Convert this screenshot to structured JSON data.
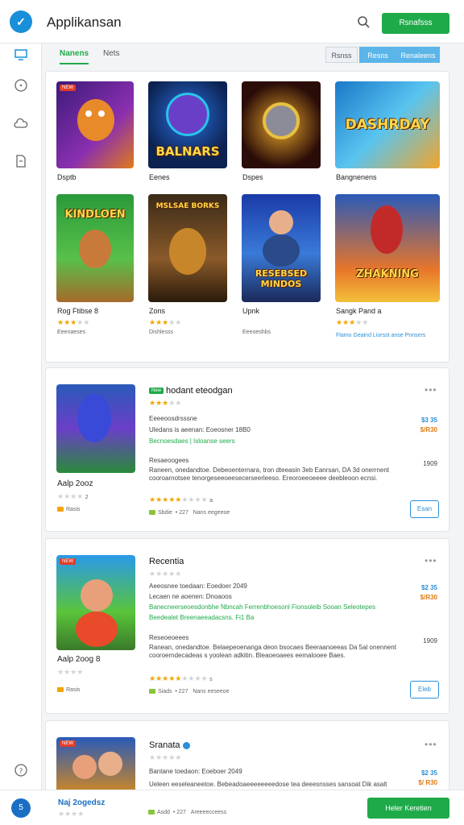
{
  "header": {
    "logo_letter": "✓",
    "title": "Applikansan",
    "primary_button": "Rsnafsss"
  },
  "tabs": [
    {
      "label": "Nanens",
      "active": true
    },
    {
      "label": "Nets",
      "active": false
    }
  ],
  "segment_buttons": [
    {
      "label": "Rsnss",
      "active": false
    },
    {
      "label": "Resns",
      "active": true
    },
    {
      "label": "Renaleens",
      "active": true
    }
  ],
  "featured": [
    {
      "name": "Dsptb",
      "art_text": "",
      "stars": 0,
      "note": ""
    },
    {
      "name": "Eenes",
      "art_text": "BALNARS",
      "stars": 0,
      "note": ""
    },
    {
      "name": "Dspes",
      "art_text": "",
      "stars": 0,
      "note": ""
    },
    {
      "name": "Bangnenens",
      "art_text": "DASHRDAY",
      "stars": 0,
      "note": ""
    },
    {
      "name": "Rog Ftibse 8",
      "art_text": "KINDLOEN",
      "stars": 2.5,
      "note": "Eeenaeses"
    },
    {
      "name": "Zons",
      "art_text": "MSLSAE BORKS",
      "stars": 2.5,
      "note": "Dishlesss"
    },
    {
      "name": "Upnk",
      "art_text": "RESEBSED MINDOS",
      "stars": 0,
      "note": "Eeeoeshbs"
    },
    {
      "name": "Sangk Pand a",
      "art_text": "ZHAKNING",
      "stars": 2.5,
      "note": "Flamo Geaind Liorsst anse Pnnsers"
    }
  ],
  "list_items": [
    {
      "badge": "New",
      "title": "hodant eteodgan",
      "stars": 3,
      "thumb_name": "Aalp 2ooz",
      "thumb_stars": 0,
      "thumb_count": "2",
      "thumb_tag": "Rasis",
      "meta_1": "Eeeeoosdrsssne",
      "meta_2": "Uledans is aeenan: Eoeosner 18B0",
      "meta_green": "Becnoesdaes | Isloanse seers",
      "price_1": "$3 35",
      "price_2": "$/R30",
      "desc_heading": "Resaeoogees",
      "desc_date": "1909",
      "desc": "Raneen, onedandtoe. Debeoenternara, tron dteeasin 3eb Eanrsan, DA 3d onerrnent cooroarnotsee tenorgeseeoeesecerseerleeso. Ereoroeeoeeee deebleoon ecnsi.",
      "review_stars": 5,
      "review_empty": 4,
      "review_count": "a",
      "install_a": "Sbdie",
      "install_b": "• 227",
      "install_c": "Nans eegeeoe",
      "action": "Esan"
    },
    {
      "badge": "",
      "title": "Recentia",
      "stars": 0,
      "thumb_name": "Aalp 2oog 8",
      "thumb_stars": 0,
      "thumb_count": "",
      "thumb_tag": "Rasis",
      "meta_1": "Aeeosnee toedaan: Eoedoer 2049",
      "meta_2": "Lecaen ne aoenen: Dnoaoos",
      "meta_green": "Banecneerseoesdonbhe Nbncah Ferrenbhoesonl Fionsoleib Sooan Seleotepes",
      "meta_green_2": "Beedealet Breenaeeadacsns. Fi1 Ba",
      "price_1": "$2 35",
      "price_2": "$/R30",
      "desc_heading": "Reseoeoeees",
      "desc_date": "1909",
      "desc": "Ranean, onedandtoe. Belaepeoenanga deon bsocaes Beeraanoeeas Da 5al onennent cooroerndecadeas s yoolean adkitin. Bleaoeoaees eemalooee Baes.",
      "review_stars": 5,
      "review_empty": 4,
      "review_count": "s",
      "install_a": "Siads",
      "install_b": "• 227",
      "install_c": "Nans eeseeoe",
      "action": "Eleb"
    },
    {
      "badge": "",
      "title": "Sranata",
      "stars": 0,
      "thumb_name": "Naj 2ogedsz",
      "meta_1": "Bantane toedaon: Eoeboer 2049",
      "price_1": "$2 35",
      "price_2": "$/ R30",
      "desc": "Ueleen eeseleaneetoe. Bebeadoaeeeeeeeedose tea deeesnsses sansoat Dik asalt",
      "install_a": "Asdd",
      "install_b": "• 227",
      "install_c": "Areeeecceess"
    }
  ],
  "bottom": {
    "avatar": "5",
    "button": "Heler Keretien"
  },
  "colors": {
    "accent_green": "#1faa4a",
    "accent_blue": "#2a8fd8",
    "star": "#f2a500"
  }
}
